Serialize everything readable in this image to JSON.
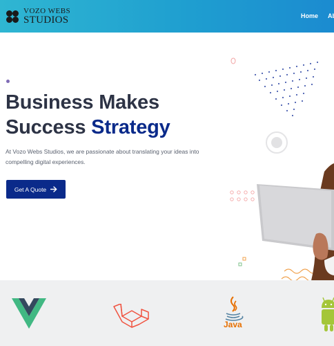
{
  "header": {
    "logo_line1": "VOZO WEBS",
    "logo_line2": "STUDIOS",
    "nav": [
      "Home",
      "Ab"
    ]
  },
  "hero": {
    "headline_line1": "Business Makes",
    "headline_line2_plain": "Success ",
    "headline_line2_accent": "Strategy",
    "subtext": "At Vozo Webs Studios, we are passionate about translating your ideas into compelling digital experiences.",
    "cta_label": "Get A Quote",
    "cta_icon": "arrow-right-icon"
  },
  "tech_logos": {
    "items": [
      "vue-logo",
      "laravel-logo",
      "java-logo",
      "android-logo"
    ],
    "java_label": "Java"
  },
  "colors": {
    "header_start": "#2fb6d2",
    "header_end": "#1b8bd0",
    "headline": "#2d3345",
    "accent": "#0a2a8a",
    "strip_bg": "#eff0f1"
  }
}
